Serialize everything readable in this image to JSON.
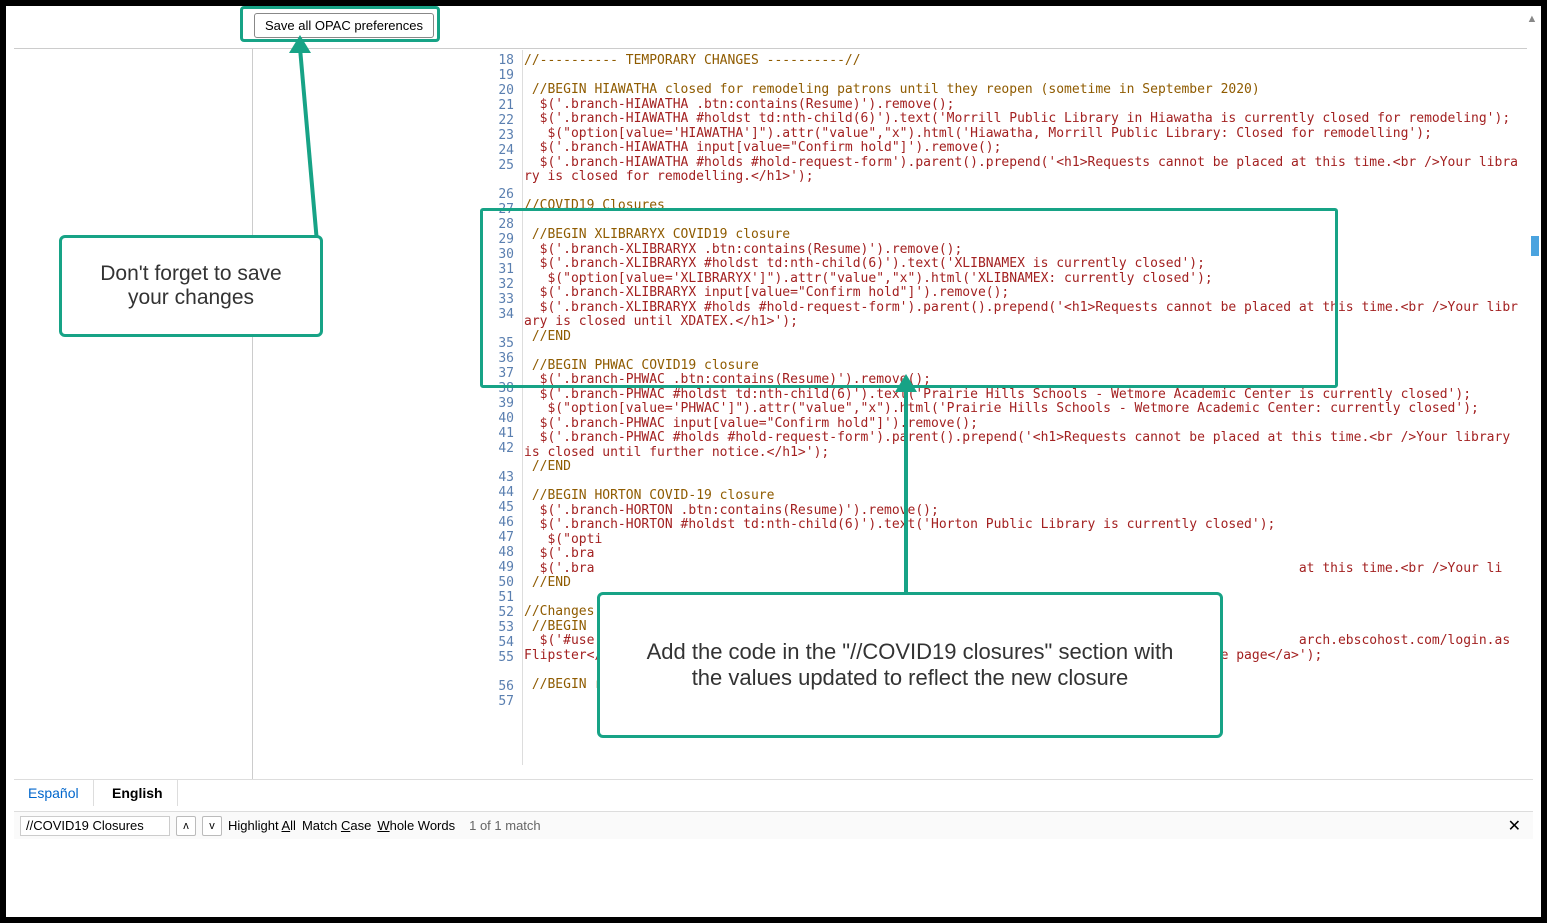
{
  "save_button_label": "Save all OPAC preferences",
  "callouts": {
    "save": "Don't forget to save your changes",
    "code": "Add the code in the \"//COVID19 closures\" section with the values updated to reflect the new closure"
  },
  "code_lines": [
    {
      "n": 18,
      "t": "//---------- TEMPORARY CHANGES ----------//",
      "cls": "cm"
    },
    {
      "n": 19,
      "t": "",
      "cls": "plain"
    },
    {
      "n": 20,
      "t": " //BEGIN HIAWATHA closed for remodeling patrons until they reopen (sometime in September 2020)",
      "cls": "cm"
    },
    {
      "n": 21,
      "t": "  $('.branch-HIAWATHA .btn:contains(Resume)').remove();",
      "cls": "kw"
    },
    {
      "n": 22,
      "t": "  $('.branch-HIAWATHA #holdst td:nth-child(6)').text('Morrill Public Library in Hiawatha is currently closed for remodeling');",
      "cls": "kw"
    },
    {
      "n": 23,
      "t": "   $(\"option[value='HIAWATHA']\").attr(\"value\",\"x\").html('Hiawatha, Morrill Public Library: Closed for remodelling');",
      "cls": "kw"
    },
    {
      "n": 24,
      "t": "  $('.branch-HIAWATHA input[value=\"Confirm hold\"]').remove();",
      "cls": "kw"
    },
    {
      "n": 25,
      "t": "  $('.branch-HIAWATHA #holds #hold-request-form').parent().prepend('<h1>Requests cannot be placed at this time.<br />Your library is closed for remodelling.</h1>');",
      "cls": "kw"
    },
    {
      "n": 26,
      "t": "",
      "cls": "plain"
    },
    {
      "n": 27,
      "t": "//COVID19 Closures",
      "cls": "cm"
    },
    {
      "n": 28,
      "t": "",
      "cls": "plain"
    },
    {
      "n": 29,
      "t": " //BEGIN XLIBRARYX COVID19 closure",
      "cls": "cm"
    },
    {
      "n": 30,
      "t": "  $('.branch-XLIBRARYX .btn:contains(Resume)').remove();",
      "cls": "kw"
    },
    {
      "n": 31,
      "t": "  $('.branch-XLIBRARYX #holdst td:nth-child(6)').text('XLIBNAMEX is currently closed');",
      "cls": "kw"
    },
    {
      "n": 32,
      "t": "   $(\"option[value='XLIBRARYX']\").attr(\"value\",\"x\").html('XLIBNAMEX: currently closed');",
      "cls": "kw"
    },
    {
      "n": 33,
      "t": "  $('.branch-XLIBRARYX input[value=\"Confirm hold\"]').remove();",
      "cls": "kw"
    },
    {
      "n": 34,
      "t": "  $('.branch-XLIBRARYX #holds #hold-request-form').parent().prepend('<h1>Requests cannot be placed at this time.<br />Your library is closed until XDATEX.</h1>');",
      "cls": "kw"
    },
    {
      "n": 35,
      "t": " //END",
      "cls": "cm"
    },
    {
      "n": 36,
      "t": "",
      "cls": "plain"
    },
    {
      "n": 37,
      "t": " //BEGIN PHWAC COVID19 closure",
      "cls": "cm"
    },
    {
      "n": 38,
      "t": "  $('.branch-PHWAC .btn:contains(Resume)').remove();",
      "cls": "kw"
    },
    {
      "n": 39,
      "t": "  $('.branch-PHWAC #holdst td:nth-child(6)').text('Prairie Hills Schools - Wetmore Academic Center is currently closed');",
      "cls": "kw"
    },
    {
      "n": 40,
      "t": "   $(\"option[value='PHWAC']\").attr(\"value\",\"x\").html('Prairie Hills Schools - Wetmore Academic Center: currently closed');",
      "cls": "kw"
    },
    {
      "n": 41,
      "t": "  $('.branch-PHWAC input[value=\"Confirm hold\"]').remove();",
      "cls": "kw"
    },
    {
      "n": 42,
      "t": "  $('.branch-PHWAC #holds #hold-request-form').parent().prepend('<h1>Requests cannot be placed at this time.<br />Your library is closed until further notice.</h1>');",
      "cls": "kw"
    },
    {
      "n": 43,
      "t": " //END",
      "cls": "cm"
    },
    {
      "n": 44,
      "t": "",
      "cls": "plain"
    },
    {
      "n": 45,
      "t": " //BEGIN HORTON COVID-19 closure",
      "cls": "cm"
    },
    {
      "n": 46,
      "t": "  $('.branch-HORTON .btn:contains(Resume)').remove();",
      "cls": "kw"
    },
    {
      "n": 47,
      "t": "  $('.branch-HORTON #holdst td:nth-child(6)').text('Horton Public Library is currently closed');",
      "cls": "kw"
    },
    {
      "n": 48,
      "t": "   $(\"opti",
      "cls": "kw"
    },
    {
      "n": 49,
      "t": "  $('.bra",
      "cls": "kw"
    },
    {
      "n": 50,
      "t": "  $('.bra                                                                                          at this time.<br />Your li",
      "cls": "kw"
    },
    {
      "n": 51,
      "t": " //END",
      "cls": "cm"
    },
    {
      "n": 52,
      "t": "",
      "cls": "plain"
    },
    {
      "n": 53,
      "t": "//Changes",
      "cls": "cm"
    },
    {
      "n": 54,
      "t": " //BEGIN",
      "cls": "cm"
    },
    {
      "n": 55,
      "t": "  $('#use                                                                                          arch.ebscohost.com/login.as                                                                                                            Flipster</a>&nbsp;&nbsp;&nbsp;&nbsp;&nbsp;<a href=\"https://nextkansas.org/\">Go to the home page</a>');",
      "cls": "kw"
    },
    {
      "n": 56,
      "t": "",
      "cls": "plain"
    },
    {
      "n": 57,
      "t": " //BEGIN rename \"Note\" to \"Report a problem\"",
      "cls": "cm"
    }
  ],
  "langs": {
    "es": "Español",
    "en": "English"
  },
  "find_bar": {
    "value": "//COVID19 Closures",
    "highlight": "Highlight All",
    "matchcase": "Match Case",
    "wholewords": "Whole Words",
    "count": "1 of 1 match"
  },
  "colors": {
    "accent": "#17a386",
    "comment": "#8f5b00",
    "code": "#a32121"
  }
}
